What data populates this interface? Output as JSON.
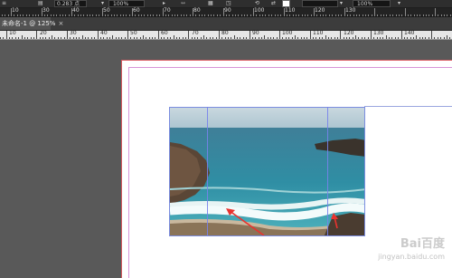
{
  "toolbar": {
    "stroke_weight": "0.283 点",
    "zoom": "100%",
    "opacity": "100%"
  },
  "ruler_top": {
    "labels": [
      "10",
      "30",
      "40",
      "50",
      "60",
      "70",
      "80",
      "90",
      "100",
      "110",
      "120",
      "130"
    ]
  },
  "tab": {
    "title": "未命名-1 @ 125%",
    "close": "×"
  },
  "ruler_doc": {
    "labels": [
      "10",
      "20",
      "30",
      "40",
      "50",
      "60",
      "70",
      "80",
      "90",
      "100",
      "110",
      "120",
      "130",
      "140"
    ]
  },
  "watermark": {
    "text": "Bai百度",
    "url": "jingyan.baidu.com"
  },
  "colors": {
    "app_bg": "#595959",
    "page_border": "#d7595f",
    "frame": "#7b8de0",
    "arrow": "#e8332f"
  }
}
